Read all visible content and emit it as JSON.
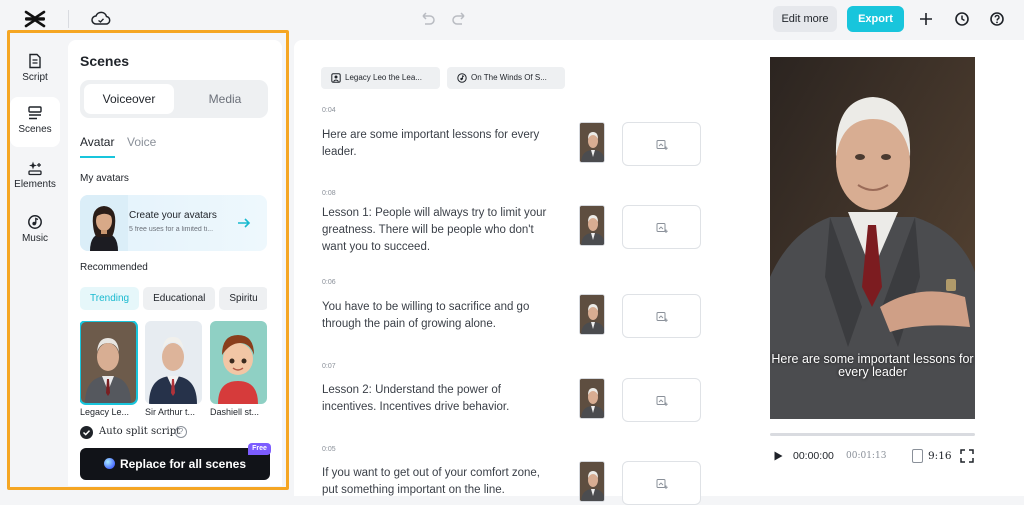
{
  "topbar": {
    "edit_more": "Edit more",
    "export": "Export",
    "icons": [
      "capcut-logo-icon",
      "cloud-icon",
      "undo-icon",
      "redo-icon",
      "plus-icon",
      "history-icon",
      "help-icon"
    ]
  },
  "leftnav": {
    "items": [
      {
        "label": "Script",
        "icon": "script-icon",
        "active": false
      },
      {
        "label": "Scenes",
        "icon": "scenes-icon",
        "active": true
      },
      {
        "label": "Elements",
        "icon": "elements-icon",
        "active": false
      },
      {
        "label": "Music",
        "icon": "music-icon",
        "active": false
      }
    ]
  },
  "panel": {
    "title": "Scenes",
    "segment": {
      "selected": "Voiceover",
      "other": "Media"
    },
    "subtabs": {
      "active": "Avatar",
      "other": "Voice"
    },
    "my_avatars_label": "My avatars",
    "create": {
      "title": "Create your avatars",
      "subtitle": "5 free uses for a limited ti..."
    },
    "recommended_label": "Recommended",
    "chips": [
      {
        "label": "Trending",
        "active": true
      },
      {
        "label": "Educational",
        "active": false
      },
      {
        "label": "Spiritu",
        "active": false
      }
    ],
    "avatars": [
      {
        "name": "Legacy Le...",
        "selected": true
      },
      {
        "name": "Sir Arthur t...",
        "selected": false
      },
      {
        "name": "Dashiell st...",
        "selected": false
      }
    ],
    "auto_split": {
      "label": "Auto split script",
      "checked": true
    },
    "replace_button": "Replace for all scenes",
    "free_badge": "Free"
  },
  "main": {
    "pills": [
      "Legacy Leo the Lea...",
      "On The Winds Of S..."
    ],
    "scenes": [
      {
        "time": "0:04",
        "text": "Here are some important lessons for every leader."
      },
      {
        "time": "0:08",
        "text": "Lesson 1: People will always try to limit your greatness. There will be people who don't want you to succeed."
      },
      {
        "time": "0:06",
        "text": "You have to be willing to sacrifice and go through the pain of growing alone."
      },
      {
        "time": "0:07",
        "text": "Lesson 2: Understand the power of incentives. Incentives drive behavior."
      },
      {
        "time": "0:05",
        "text": "If you want to get out of your comfort zone, put something important on the line."
      }
    ]
  },
  "preview": {
    "caption": "Here are some important lessons for every leader",
    "current_time": "00:00:00",
    "total_time": "00:01:13",
    "ratio": "9:16",
    "progress": 0
  },
  "colors": {
    "accent": "#18c5dc",
    "highlight_border": "#f5a623",
    "free_badge": "#7c5cff"
  }
}
